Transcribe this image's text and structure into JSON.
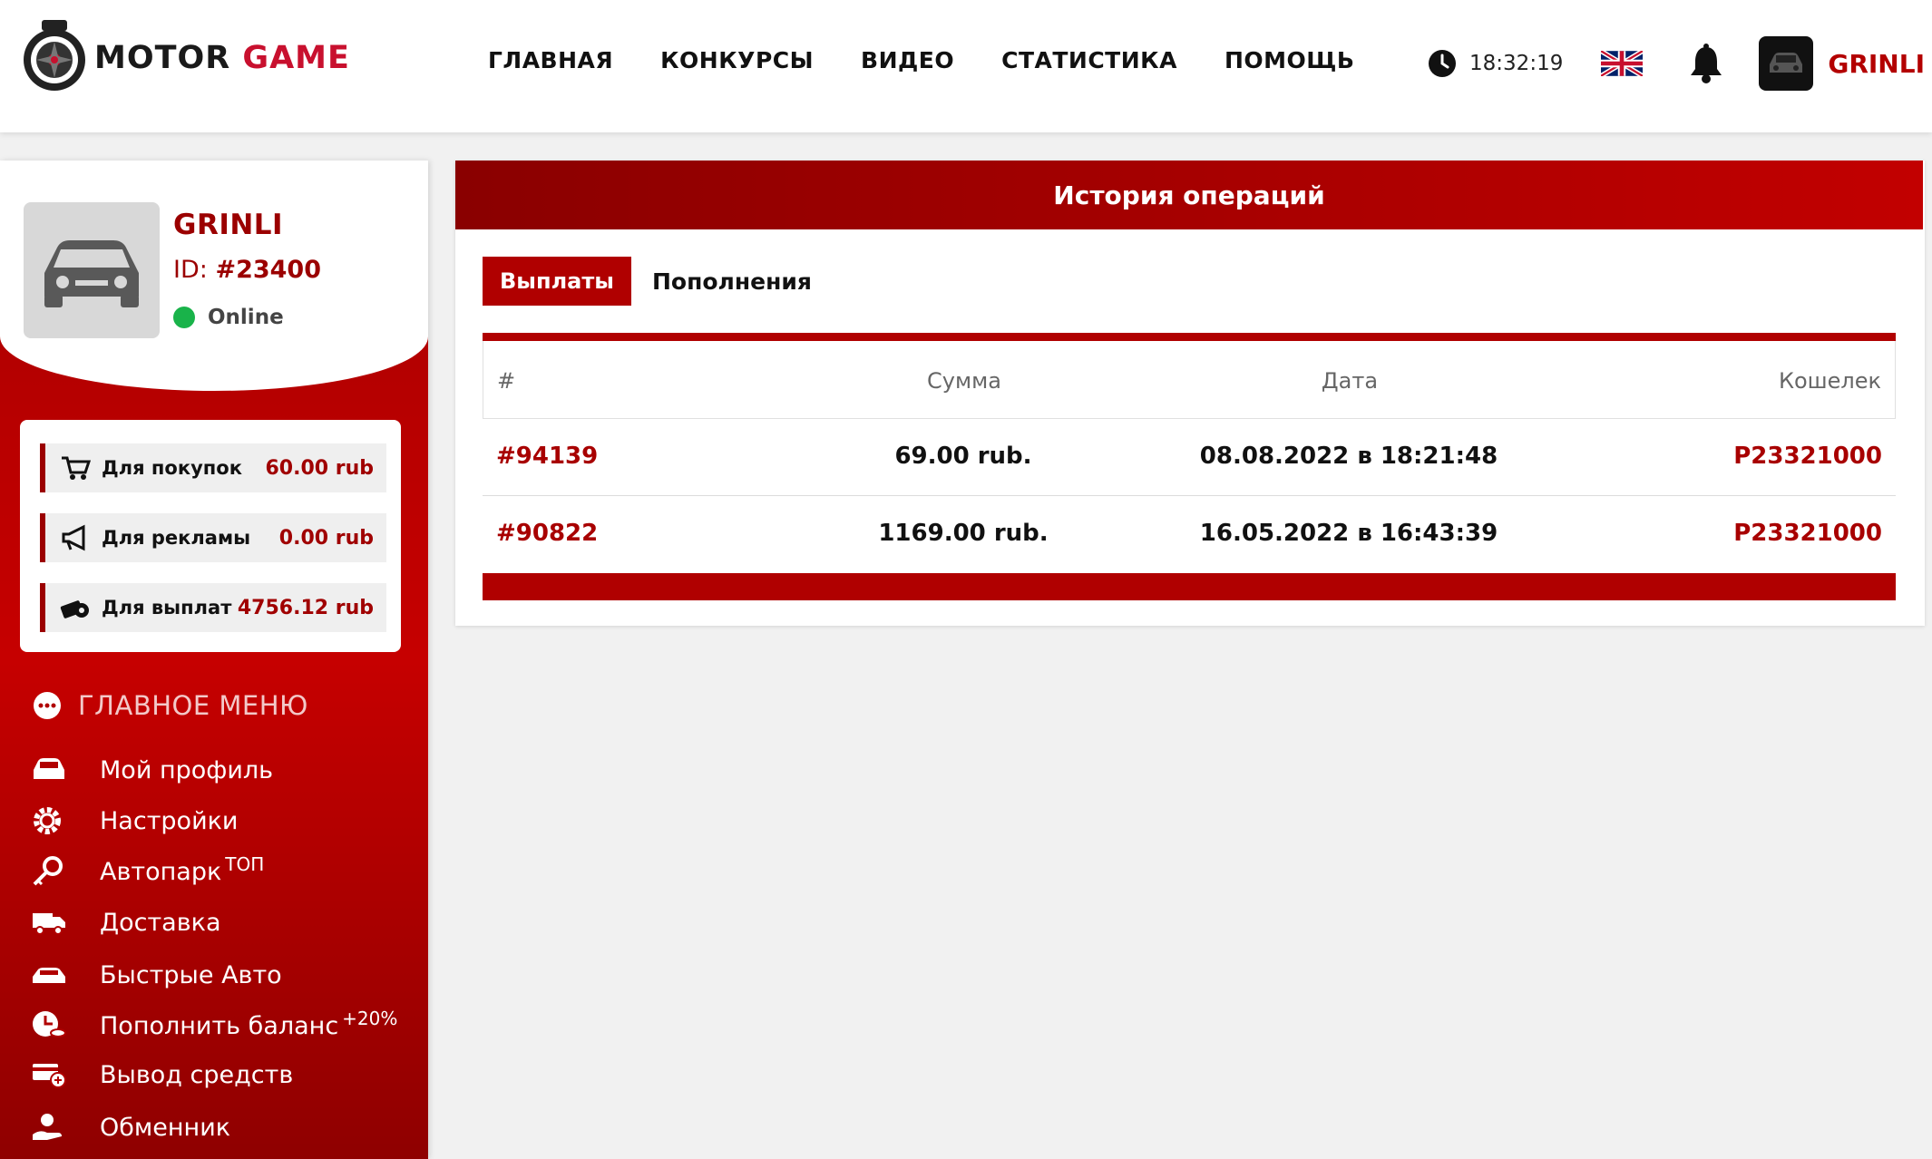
{
  "header": {
    "logo": {
      "word1": "MOTOR",
      "word2": "GAME"
    },
    "nav": [
      "ГЛАВНАЯ",
      "КОНКУРСЫ",
      "ВИДЕО",
      "СТАТИСТИКА",
      "ПОМОЩЬ"
    ],
    "time": "18:32:19",
    "username": "GRINLI"
  },
  "profile": {
    "name": "GRINLI",
    "id_label": "ID:",
    "id_value": "#23400",
    "status": "Online"
  },
  "balances": [
    {
      "label": "Для покупок",
      "value": "60.00 rub",
      "icon": "cart-icon"
    },
    {
      "label": "Для рекламы",
      "value": "0.00 rub",
      "icon": "megaphone-icon"
    },
    {
      "label": "Для выплат",
      "value": "4756.12 rub",
      "icon": "money-icon"
    }
  ],
  "menu": {
    "title": "ГЛАВНОЕ МЕНЮ",
    "items": [
      {
        "label": "Мой профиль",
        "sup": ""
      },
      {
        "label": "Настройки",
        "sup": ""
      },
      {
        "label": "Автопарк",
        "sup": "ТОП"
      },
      {
        "label": "Доставка",
        "sup": ""
      },
      {
        "label": "Быстрые Авто",
        "sup": ""
      },
      {
        "label": "Пополнить баланс",
        "sup": "+20%"
      },
      {
        "label": "Вывод средств",
        "sup": ""
      },
      {
        "label": "Обменник",
        "sup": ""
      }
    ]
  },
  "operations": {
    "title": "История операций",
    "tabs": [
      "Выплаты",
      "Пополнения"
    ],
    "columns": [
      "#",
      "Сумма",
      "Дата",
      "Кошелек"
    ],
    "rows": [
      {
        "id": "#94139",
        "amount": "69.00 rub.",
        "date": "08.08.2022 в 18:21:48",
        "wallet": "P23321000"
      },
      {
        "id": "#90822",
        "amount": "1169.00 rub.",
        "date": "16.05.2022 в 16:43:39",
        "wallet": "P23321000"
      }
    ]
  },
  "colors": {
    "accent": "#b00000",
    "dark_red": "#8a0000",
    "online": "#19b34a"
  }
}
